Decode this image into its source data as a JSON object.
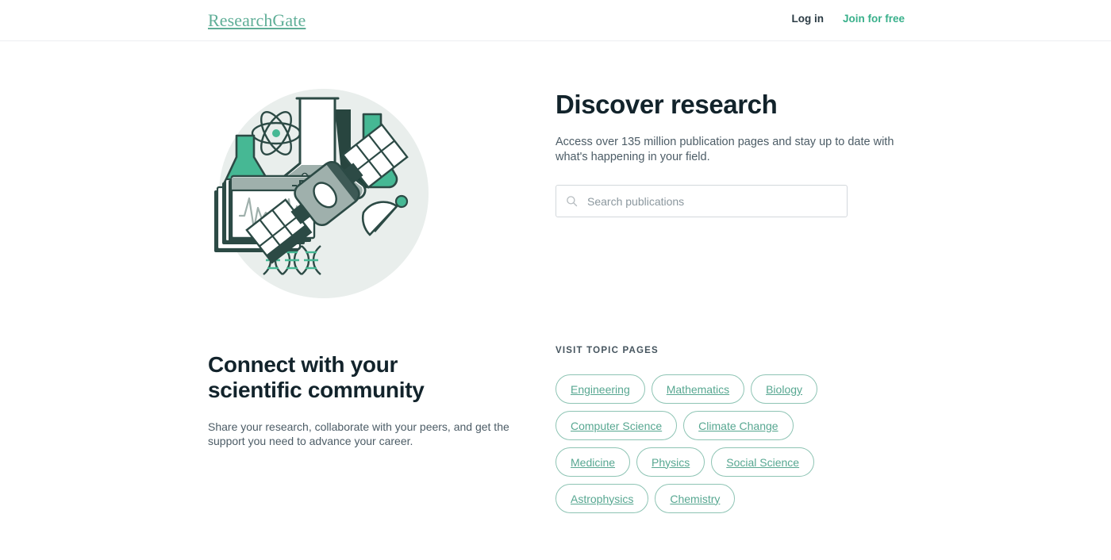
{
  "header": {
    "logo": "ResearchGate",
    "login_label": "Log in",
    "join_label": "Join for free"
  },
  "hero": {
    "title": "Discover research",
    "subtitle": "Access over 135 million publication pages and stay up to date with what's happening in your field.",
    "search_placeholder": "Search publications",
    "search_value": "",
    "illustration": {
      "name": "science-research-illustration",
      "elements": [
        "atom-icon",
        "lab-flasks-icon",
        "window-ecg-icon",
        "dna-helix-icon",
        "satellite-icon"
      ]
    }
  },
  "community": {
    "title_line1": "Connect with your",
    "title_line2": "scientific community",
    "subtitle": "Share your research, collaborate with your peers, and get the support you need to advance your career."
  },
  "topics": {
    "label": "VISIT TOPIC PAGES",
    "items": [
      {
        "label": "Engineering"
      },
      {
        "label": "Mathematics"
      },
      {
        "label": "Biology"
      },
      {
        "label": "Computer Science"
      },
      {
        "label": "Climate Change"
      },
      {
        "label": "Medicine"
      },
      {
        "label": "Physics"
      },
      {
        "label": "Social Science"
      },
      {
        "label": "Astrophysics"
      },
      {
        "label": "Chemistry"
      }
    ]
  },
  "colors": {
    "brand_teal": "#39b08b",
    "logo_teal": "#5fae97",
    "chip_border": "#8ec4b4",
    "chip_text": "#57a791",
    "heading_dark": "#12232b",
    "body_text": "#4c5c66",
    "illustration_circle": "#e9eeec",
    "illustration_outline": "#2c4a45",
    "illustration_gray": "#9fb0ac",
    "illustration_teal": "#46b894"
  }
}
